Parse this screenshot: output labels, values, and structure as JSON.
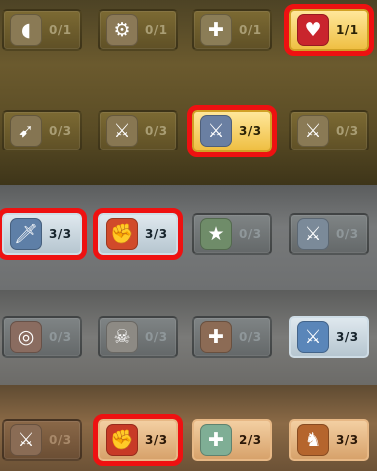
{
  "rows": [
    {
      "tiles": [
        {
          "icon": "horn-icon",
          "value": "0/1"
        },
        {
          "icon": "skill-tree-icon",
          "value": "0/1"
        },
        {
          "icon": "medal-plus-icon",
          "value": "0/1"
        },
        {
          "icon": "heart-icon",
          "value": "1/1"
        }
      ]
    },
    {
      "tiles": [
        {
          "icon": "blade-icon",
          "value": "0/3"
        },
        {
          "icon": "sword-shield-icon",
          "value": "0/3"
        },
        {
          "icon": "crossed-swords-troops-icon",
          "value": "3/3"
        },
        {
          "icon": "crossed-swords-clock-icon",
          "value": "0/3"
        }
      ]
    },
    {
      "tiles": [
        {
          "icon": "sword-icon",
          "value": "3/3"
        },
        {
          "icon": "fist-icon",
          "value": "3/3"
        },
        {
          "icon": "star-plus-icon",
          "value": "0/3"
        },
        {
          "icon": "crossed-swords-plus-icon",
          "value": "0/3"
        }
      ]
    },
    {
      "tiles": [
        {
          "icon": "target-icon",
          "value": "0/3"
        },
        {
          "icon": "skull-heart-icon",
          "value": "0/3"
        },
        {
          "icon": "bag-plus-icon",
          "value": "0/3"
        },
        {
          "icon": "crossed-swords-troops-icon",
          "value": "3/3"
        }
      ]
    },
    {
      "tiles": [
        {
          "icon": "sword-shield-icon",
          "value": "0/3"
        },
        {
          "icon": "fist-icon",
          "value": "3/3"
        },
        {
          "icon": "map-plus-icon",
          "value": "2/3"
        },
        {
          "icon": "horse-icon",
          "value": "3/3"
        }
      ]
    }
  ],
  "colors": {
    "highlight": "#ee1111",
    "gold_active": "#f1c44a",
    "silver_active": "#c8d6df",
    "bronze_active": "#dfae78"
  }
}
